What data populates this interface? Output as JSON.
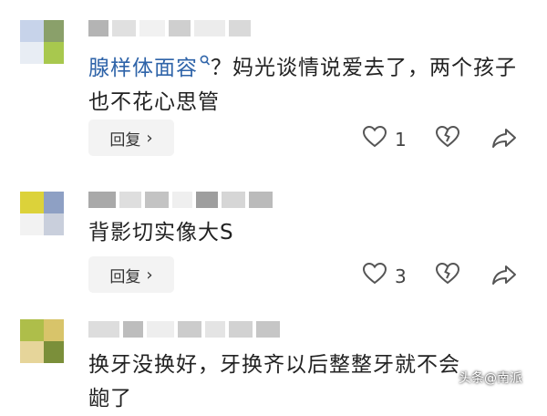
{
  "comments": [
    {
      "text_highlight": "腺样体面容",
      "text_rest": "？妈光谈情说爱去了，两个孩子也不花心思管",
      "reply_label": "回复",
      "like_count": "1"
    },
    {
      "text": "背影切实像大S",
      "reply_label": "回复",
      "like_count": "3"
    },
    {
      "text": "换牙没换好，牙换齐以后整整牙就不会",
      "text_cut": "龅了"
    }
  ],
  "watermark": "头条@南派",
  "icons": {
    "search": "search-icon",
    "like": "heart-icon",
    "dislike": "broken-heart-icon",
    "share": "share-icon",
    "chevron": "chevron-right-icon"
  },
  "colors": {
    "highlight": "#2f64a9",
    "reply_bg": "#f3f3f3"
  }
}
